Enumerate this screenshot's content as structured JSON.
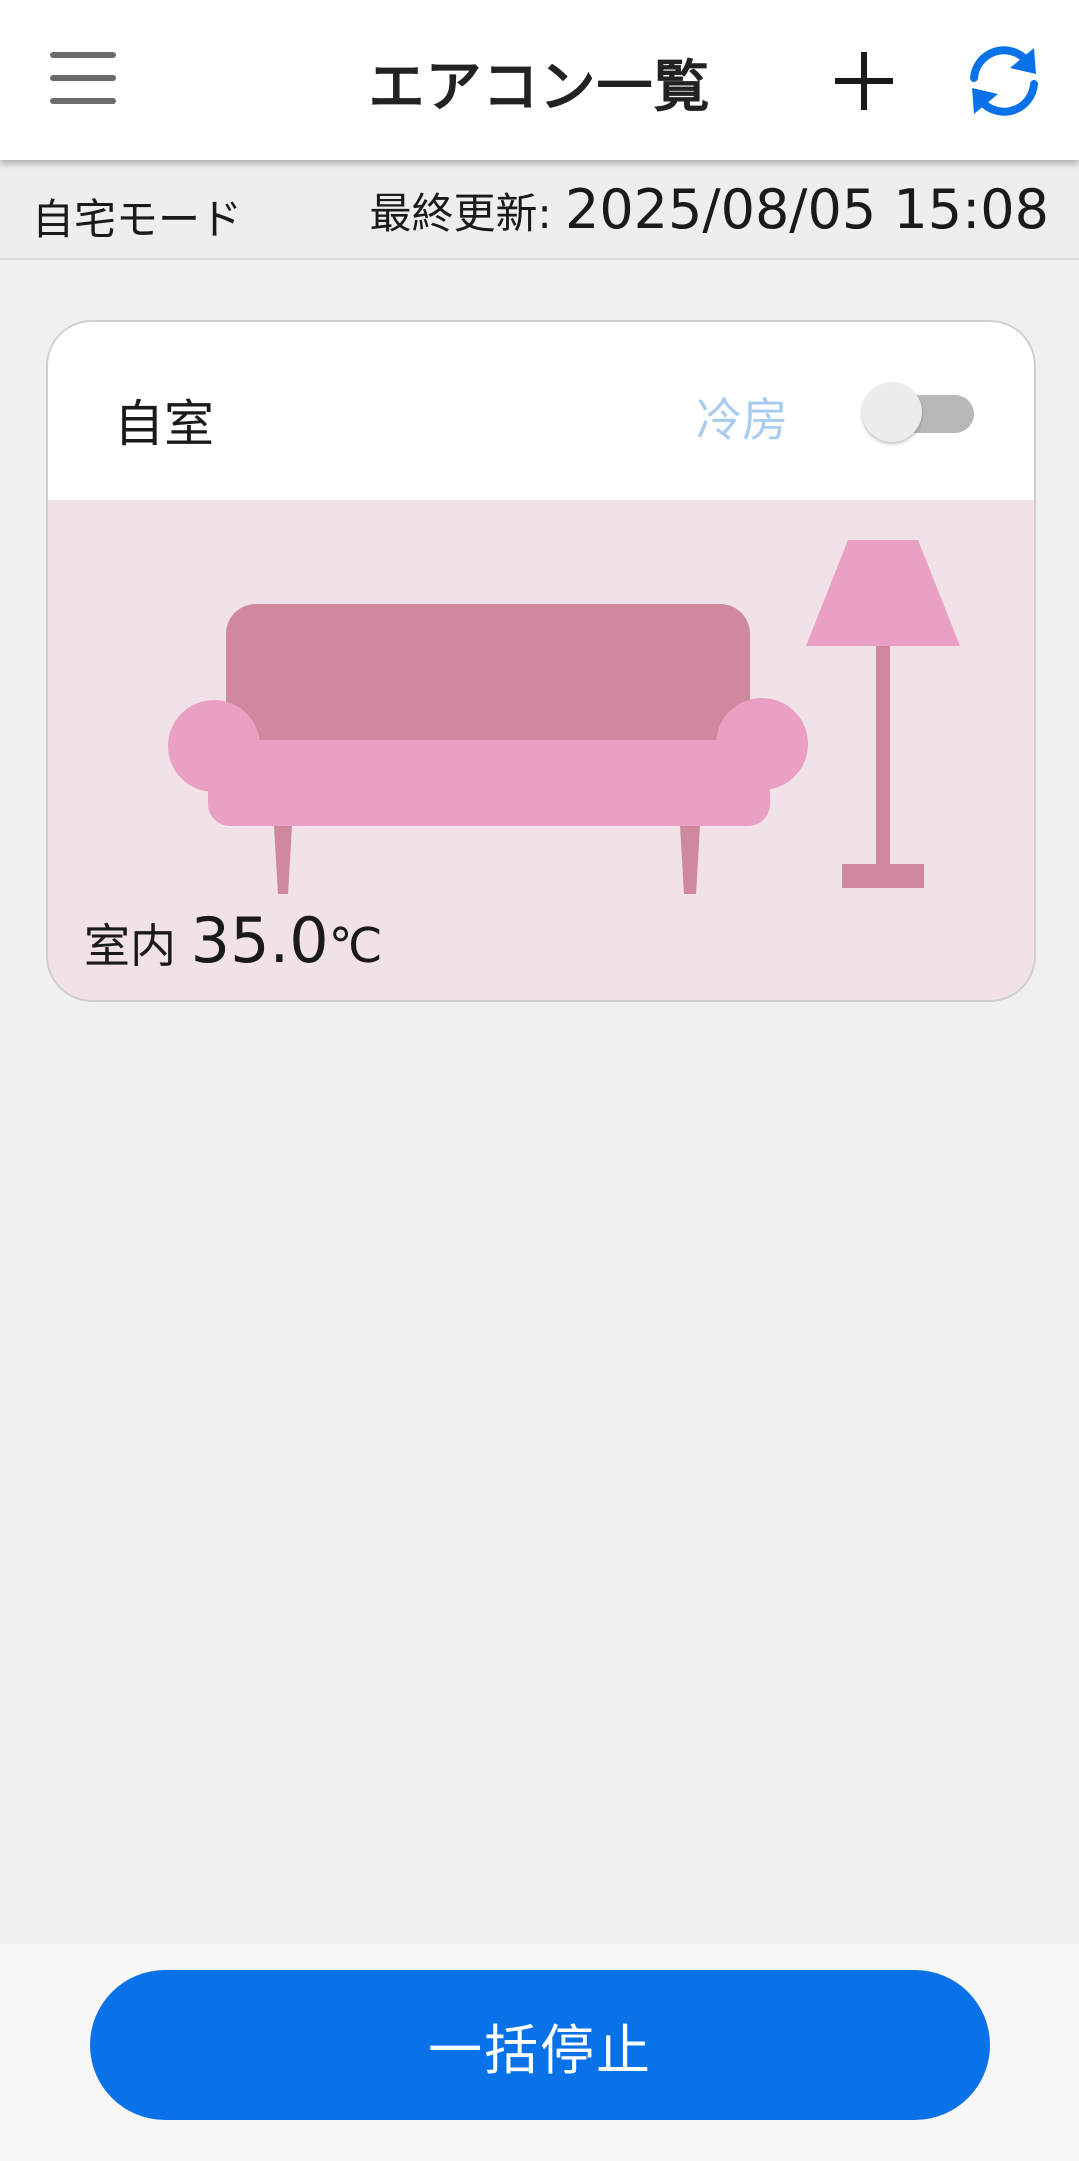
{
  "header": {
    "title": "エアコン一覧",
    "menu_icon": "hamburger-menu-icon",
    "add_icon": "plus-icon",
    "refresh_icon": "refresh-icon",
    "refresh_color": "#0a72e8"
  },
  "status": {
    "mode": "自宅モード",
    "updated_label": "最終更新: ",
    "updated_time": "2025/08/05 15:08"
  },
  "rooms": [
    {
      "name": "自室",
      "mode": "冷房",
      "power_on": false,
      "indoor_label": "室内",
      "indoor_temp": "35.0",
      "temp_unit": "℃",
      "illustration": "sofa-and-lamp-illustration",
      "background_color": "#f0e2e8"
    }
  ],
  "footer": {
    "stop_all_label": "一括停止",
    "button_color": "#0a72e8"
  }
}
